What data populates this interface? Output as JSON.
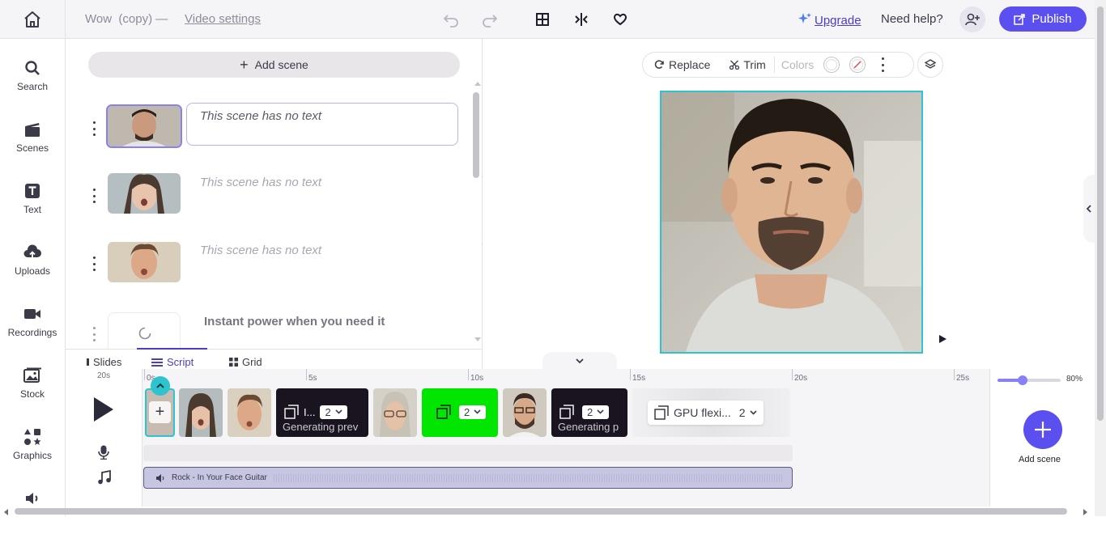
{
  "topbar": {
    "project_title": "Wow  (copy)",
    "separator": "—",
    "video_settings_link": "Video settings",
    "upgrade_label": "Upgrade",
    "help_label": "Need help?",
    "publish_label": "Publish"
  },
  "sidebar": {
    "items": [
      {
        "label": "Search",
        "icon": "search-icon"
      },
      {
        "label": "Scenes",
        "icon": "clapperboard-icon"
      },
      {
        "label": "Text",
        "icon": "text-icon"
      },
      {
        "label": "Uploads",
        "icon": "cloud-upload-icon"
      },
      {
        "label": "Recordings",
        "icon": "video-camera-icon"
      },
      {
        "label": "Stock",
        "icon": "image-icon"
      },
      {
        "label": "Graphics",
        "icon": "shapes-icon"
      },
      {
        "label": "",
        "icon": "speaker-icon"
      }
    ]
  },
  "script": {
    "add_scene_label": "Add scene",
    "scenes": [
      {
        "text": "This scene has no text"
      },
      {
        "text": "This scene has no text"
      },
      {
        "text": "This scene has no text"
      },
      {
        "text": "Instant power when you need it"
      }
    ],
    "tabs": [
      "Slides",
      "Script",
      "Grid"
    ],
    "active_tab": "Script"
  },
  "preview": {
    "toolbar": {
      "replace_label": "Replace",
      "trim_label": "Trim",
      "colors_label": "Colors"
    }
  },
  "timeline": {
    "duration_label": "20s",
    "ticks": [
      "0s",
      "5s",
      "10s",
      "15s",
      "20s",
      "25s"
    ],
    "clips": [
      {
        "kind": "face",
        "label": ""
      },
      {
        "kind": "face",
        "label": ""
      },
      {
        "kind": "face",
        "label": ""
      },
      {
        "kind": "generating",
        "label": "I...",
        "count": "2",
        "caption": "Generating prev"
      },
      {
        "kind": "face",
        "label": ""
      },
      {
        "kind": "green",
        "label": "",
        "count": "2"
      },
      {
        "kind": "face",
        "label": ""
      },
      {
        "kind": "generating",
        "label": "",
        "count": "2",
        "caption": "Generating p"
      },
      {
        "kind": "gpu",
        "label": "GPU flexi...",
        "count": "2"
      }
    ],
    "audio_track": "Rock - In Your Face Guitar",
    "zoom_label": "80%",
    "zoom_value": 0.4,
    "add_scene_label": "Add scene"
  },
  "colors": {
    "accent": "#5b4ff0",
    "selection": "#2ec3cf",
    "green_screen": "#00e600"
  }
}
